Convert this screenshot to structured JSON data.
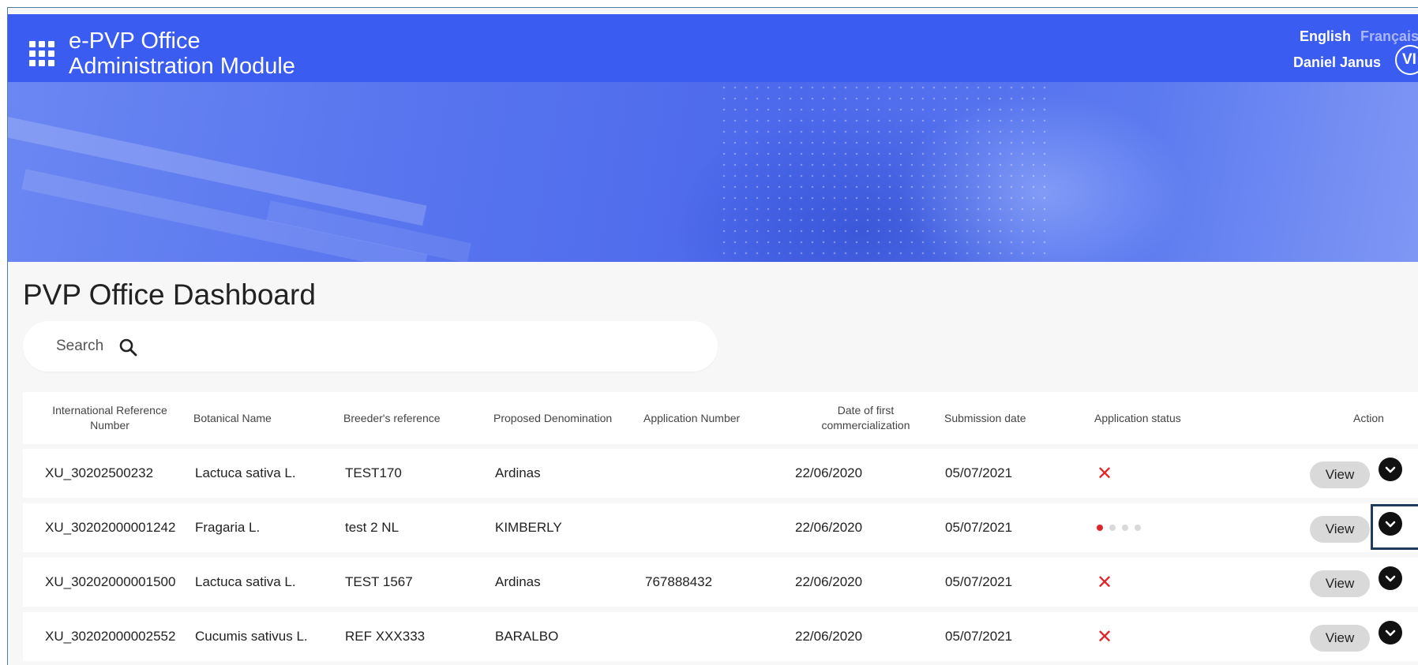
{
  "header": {
    "app_title": "e-PVP Office\nAdministration Module",
    "languages": {
      "active": "English",
      "other": "Français"
    },
    "user_name": "Daniel Janus",
    "avatar_initials": "VI"
  },
  "dashboard": {
    "title": "PVP Office Dashboard",
    "search": {
      "placeholder": "Search"
    }
  },
  "table": {
    "columns": [
      "International Reference Number",
      "Botanical Name",
      "Breeder's reference",
      "Proposed Denomination",
      "Application Number",
      "Date of first commercialization",
      "Submission date",
      "Application status",
      "Action"
    ],
    "rows": [
      {
        "ref": "XU_30202500232",
        "botanical": "Lactuca sativa L.",
        "breeder_ref": "TEST170",
        "denomination": "Ardinas",
        "app_number": "",
        "first_comm": "22/06/2020",
        "submission": "05/07/2021",
        "status": "rejected",
        "status_icon": "x-icon",
        "action": "View"
      },
      {
        "ref": "XU_30202000001242",
        "botanical": "Fragaria L.",
        "breeder_ref": "test 2 NL",
        "denomination": "KIMBERLY",
        "app_number": "",
        "first_comm": "22/06/2020",
        "submission": "05/07/2021",
        "status": "progress",
        "progress_step": 1,
        "progress_total": 4,
        "action": "View"
      },
      {
        "ref": "XU_30202000001500",
        "botanical": "Lactuca sativa L.",
        "breeder_ref": "TEST 1567",
        "denomination": "Ardinas",
        "app_number": "767888432",
        "first_comm": "22/06/2020",
        "submission": "05/07/2021",
        "status": "rejected",
        "status_icon": "x-icon",
        "action": "View"
      },
      {
        "ref": "XU_30202000002552",
        "botanical": "Cucumis sativus L.",
        "breeder_ref": "REF XXX333",
        "denomination": "BARALBO",
        "app_number": "",
        "first_comm": "22/06/2020",
        "submission": "05/07/2021",
        "status": "rejected",
        "status_icon": "x-icon",
        "action": "View"
      }
    ]
  },
  "colors": {
    "header_bg": "#3a5cf0",
    "status_red": "#e0242a",
    "focus_outline": "#203c5c"
  }
}
